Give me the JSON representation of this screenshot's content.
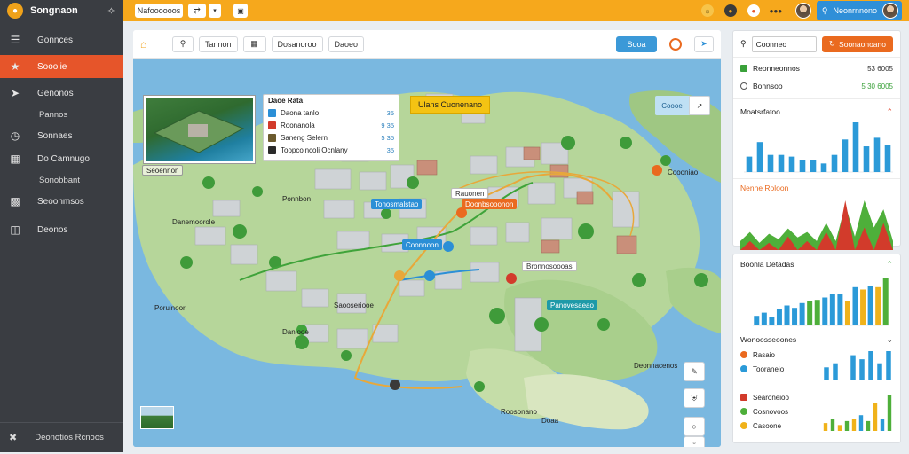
{
  "app": {
    "name": "Songnaon",
    "nav": [
      {
        "label": "Gonnces",
        "icon": "menu-icon"
      },
      {
        "label": "Sooolie",
        "icon": "star-icon",
        "active": true
      },
      {
        "label": "Genonos",
        "icon": "send-icon"
      },
      {
        "label": "Pannos",
        "icon": ""
      },
      {
        "label": "Sonnaes",
        "icon": "clock-icon"
      },
      {
        "label": "Do Camnugo",
        "icon": "grid-icon"
      },
      {
        "label": "Sonobbant",
        "icon": ""
      },
      {
        "label": "Seoonmsos",
        "icon": "card-icon"
      },
      {
        "label": "Deonos",
        "icon": "building-icon"
      }
    ],
    "footer": "Deonotios Rcnoos"
  },
  "topbar": {
    "search_label": "Nafoooooos",
    "toggle_label": "⇄",
    "user_label": "Neonrnnono"
  },
  "map": {
    "toolbar": {
      "tab_a": "Tannon",
      "tab_b": "Dosanoroo",
      "tab_c": "Daoeo",
      "primary_btn": "Sooa"
    },
    "inset_label": "Seoennon",
    "popup": {
      "title": "Daoe Rata",
      "rows": [
        {
          "label": "Daona tanlo",
          "value": "35",
          "color": "#2b8fd6"
        },
        {
          "label": "Roonanola",
          "value": "9 35",
          "color": "#d23b2b"
        },
        {
          "label": "Saneng Selern",
          "value": "5 35",
          "color": "#6b5a2e"
        },
        {
          "label": "Toopcolncoli Ocnlany",
          "value": "35",
          "color": "#2a2a2a"
        }
      ]
    },
    "badge": "Ulans Cuonenano",
    "corner_btn": "Coooe",
    "labels": [
      {
        "text": "Tonosmalstao",
        "style": "blue"
      },
      {
        "text": "Doonbsooonon",
        "style": "orange"
      },
      {
        "text": "Coonnoon",
        "style": "blue"
      },
      {
        "text": "Panovesaeao",
        "style": "teal"
      },
      {
        "text": "Bronnosoooas",
        "style": "white"
      },
      {
        "text": "Rauonen",
        "style": "white"
      },
      {
        "text": "Poruinoor",
        "style": "plain"
      },
      {
        "text": "Saooseriooe",
        "style": "plain"
      },
      {
        "text": "Daniooe",
        "style": "plain"
      },
      {
        "text": "Danemoorole",
        "style": "plain"
      },
      {
        "text": "Ponnbon",
        "style": "plain"
      },
      {
        "text": "Deonnacenos",
        "style": "plain"
      },
      {
        "text": "Roosonano",
        "style": "plain"
      },
      {
        "text": "Doaa",
        "style": "plain"
      },
      {
        "text": "Coooniao",
        "style": "plain"
      }
    ]
  },
  "panel1": {
    "input": "Coonneo",
    "button": "Soonaonoano",
    "items": [
      {
        "label": "Reonneonnos",
        "value": "53 6005",
        "color": "#3aa13a"
      },
      {
        "label": "Bonnsoo",
        "value": "5 30 6005",
        "color": "#555555"
      }
    ],
    "section_a": "Moatsrfatoo",
    "section_b": "Nenne Roloon"
  },
  "panel2": {
    "title": "Boonla Detadas",
    "subtitle": "Wonoosseoones",
    "legend": [
      {
        "label": "Rasaio",
        "color": "#ea6a1f"
      },
      {
        "label": "Tooraneio",
        "color": "#2b9ad8"
      },
      {
        "label": "Searoneioo",
        "color": "#d23b2b"
      },
      {
        "label": "Cosnovoos",
        "color": "#4eaf3a"
      },
      {
        "label": "Casoone",
        "color": "#f0b21a"
      }
    ]
  },
  "chart_data": [
    {
      "type": "bar",
      "title": "Moatsrfatoo",
      "categories": [
        "1",
        "2",
        "3",
        "4",
        "5",
        "6",
        "7",
        "8",
        "9",
        "10",
        "11",
        "12",
        "13",
        "14"
      ],
      "values": [
        18,
        35,
        20,
        20,
        18,
        14,
        14,
        10,
        20,
        38,
        58,
        30,
        40,
        32
      ],
      "colors": [
        "#2b9ad8"
      ]
    },
    {
      "type": "area",
      "title": "Nenne Roloon",
      "x": [
        0,
        1,
        2,
        3,
        4,
        5,
        6,
        7,
        8,
        9,
        10,
        11,
        12,
        13,
        14,
        15,
        16
      ],
      "series": [
        {
          "values": [
            10,
            20,
            8,
            18,
            12,
            24,
            14,
            20,
            10,
            30,
            10,
            50,
            15,
            55,
            25,
            45,
            10
          ],
          "color": "#4eaf3a"
        },
        {
          "values": [
            0,
            10,
            0,
            8,
            0,
            15,
            0,
            10,
            0,
            20,
            0,
            55,
            0,
            25,
            0,
            30,
            0
          ],
          "color": "#d23b2b"
        }
      ]
    },
    {
      "type": "bar",
      "title": "Boonla Detadas",
      "categories": [
        "1",
        "2",
        "3",
        "4",
        "5",
        "6",
        "7",
        "8",
        "9",
        "10",
        "11",
        "12",
        "13",
        "14",
        "15",
        "16",
        "17",
        "18"
      ],
      "values": [
        12,
        16,
        10,
        20,
        25,
        22,
        28,
        30,
        32,
        35,
        40,
        40,
        30,
        48,
        45,
        50,
        48,
        60
      ],
      "colors": [
        "#2b9ad8",
        "#2b9ad8",
        "#2b9ad8",
        "#2b9ad8",
        "#2b9ad8",
        "#2b9ad8",
        "#2b9ad8",
        "#4eaf3a",
        "#4eaf3a",
        "#2b9ad8",
        "#2b9ad8",
        "#2b9ad8",
        "#f0b21a",
        "#2b9ad8",
        "#f0b21a",
        "#2b9ad8",
        "#f0b21a",
        "#4eaf3a"
      ]
    },
    {
      "type": "bar",
      "title": "Rasaio",
      "values": [
        6,
        8,
        0,
        12,
        10,
        14,
        8,
        14
      ],
      "colors": [
        "#2b9ad8"
      ]
    },
    {
      "type": "bar",
      "title": "Searoneioo",
      "values": [
        4,
        6,
        3,
        5,
        6,
        8,
        5,
        14,
        6,
        18
      ],
      "colors": [
        "#f0b21a",
        "#4eaf3a",
        "#f0b21a",
        "#4eaf3a",
        "#f0b21a",
        "#2b9ad8",
        "#4eaf3a",
        "#f0b21a",
        "#2b9ad8",
        "#4eaf3a"
      ]
    }
  ]
}
